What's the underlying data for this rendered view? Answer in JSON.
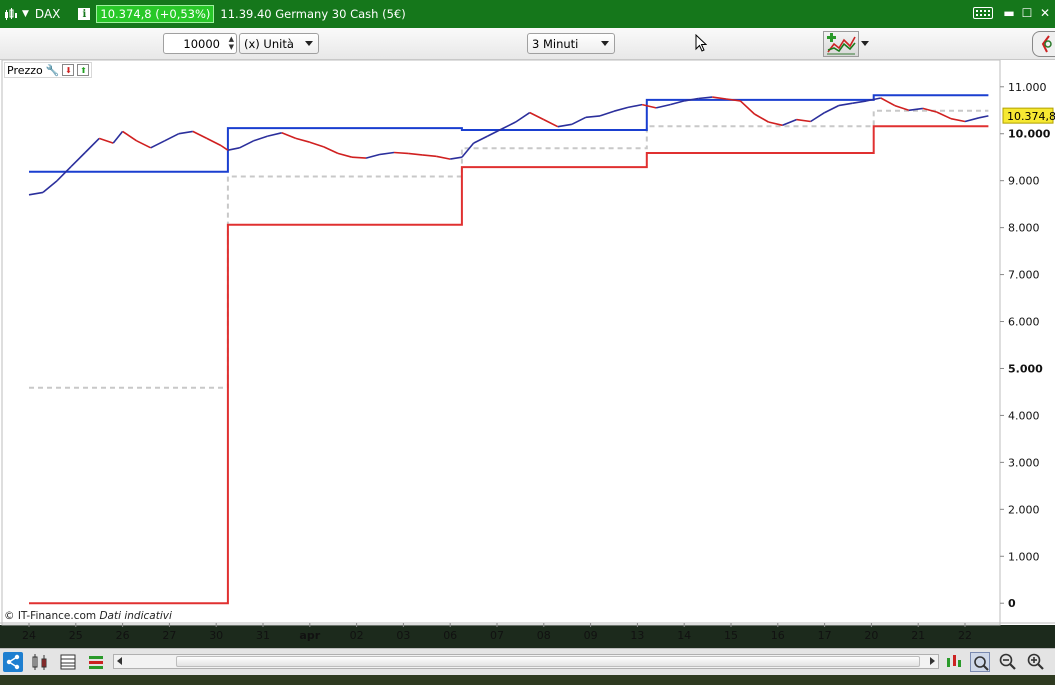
{
  "window": {
    "instrument": "DAX",
    "info_icon": "i",
    "price_badge": "10.374,8 (+0,53%)",
    "title": "11.39.40 Germany 30 Cash (5€)",
    "controls": [
      "minimize-icon",
      "maximize-icon",
      "close-icon"
    ]
  },
  "toolbar": {
    "quantity": "10000",
    "unit": "(x) Unità",
    "timeframe": "3 Minuti"
  },
  "chart_header": {
    "label": "Prezzo"
  },
  "footer": {
    "source": "© IT-Finance.com",
    "note": "Dati indicativi"
  },
  "colors": {
    "upper_channel": "#1a3fd0",
    "lower_channel": "#e03030",
    "midline": "#c8c8c8",
    "price": "#2b2f9c",
    "price_down": "#d02020",
    "last_price_bg": "#f6e832"
  },
  "chart_data": {
    "type": "line",
    "ylim": [
      -400,
      11400
    ],
    "yticks": [
      0,
      1000,
      2000,
      3000,
      4000,
      5000,
      6000,
      7000,
      8000,
      9000,
      10000,
      11000
    ],
    "ytick_labels": [
      "0",
      "1.000",
      "2.000",
      "3.000",
      "4.000",
      "5.000",
      "6.000",
      "7.000",
      "8.000",
      "9.000",
      "10.000",
      "11.000"
    ],
    "ytick_bold": [
      0,
      5000,
      10000
    ],
    "xtick_labels": [
      "24",
      "25",
      "26",
      "27",
      "30",
      "31",
      "apr",
      "02",
      "03",
      "06",
      "07",
      "08",
      "09",
      "13",
      "14",
      "15",
      "16",
      "17",
      "20",
      "21",
      "22"
    ],
    "xtick_bold": [
      "apr"
    ],
    "last_price": 10374.8,
    "last_price_label": "10.374,8",
    "upper_channel": [
      [
        0,
        9190
      ],
      [
        4.25,
        9190
      ],
      [
        4.25,
        10120
      ],
      [
        9.25,
        10120
      ],
      [
        9.25,
        10080
      ],
      [
        13.2,
        10080
      ],
      [
        13.2,
        10720
      ],
      [
        18.05,
        10720
      ],
      [
        18.05,
        10820
      ],
      [
        20.5,
        10820
      ]
    ],
    "lower_channel": [
      [
        0,
        0
      ],
      [
        4.25,
        0
      ],
      [
        4.25,
        8060
      ],
      [
        9.25,
        8060
      ],
      [
        9.25,
        9290
      ],
      [
        13.2,
        9290
      ],
      [
        13.2,
        9590
      ],
      [
        18.05,
        9590
      ],
      [
        18.05,
        10160
      ],
      [
        20.5,
        10160
      ]
    ],
    "midline": [
      [
        0,
        4590
      ],
      [
        4.25,
        4590
      ],
      [
        4.25,
        9090
      ],
      [
        9.25,
        9090
      ],
      [
        9.25,
        9690
      ],
      [
        13.2,
        9690
      ],
      [
        13.2,
        10160
      ],
      [
        18.05,
        10160
      ],
      [
        18.05,
        10490
      ],
      [
        20.5,
        10490
      ]
    ],
    "price": [
      [
        0,
        8700
      ],
      [
        0.3,
        8750
      ],
      [
        0.6,
        9000
      ],
      [
        0.9,
        9300
      ],
      [
        1.2,
        9600
      ],
      [
        1.5,
        9900
      ],
      [
        1.8,
        9800
      ],
      [
        2.0,
        10050
      ],
      [
        2.3,
        9850
      ],
      [
        2.6,
        9700
      ],
      [
        2.9,
        9850
      ],
      [
        3.2,
        10000
      ],
      [
        3.5,
        10050
      ],
      [
        3.8,
        9900
      ],
      [
        4.1,
        9750
      ],
      [
        4.25,
        9650
      ],
      [
        4.5,
        9700
      ],
      [
        4.8,
        9850
      ],
      [
        5.1,
        9950
      ],
      [
        5.4,
        10020
      ],
      [
        5.7,
        9900
      ],
      [
        6.0,
        9820
      ],
      [
        6.3,
        9720
      ],
      [
        6.6,
        9580
      ],
      [
        6.9,
        9500
      ],
      [
        7.2,
        9480
      ],
      [
        7.5,
        9560
      ],
      [
        7.8,
        9600
      ],
      [
        8.1,
        9580
      ],
      [
        8.4,
        9550
      ],
      [
        8.7,
        9520
      ],
      [
        9.0,
        9460
      ],
      [
        9.25,
        9500
      ],
      [
        9.5,
        9800
      ],
      [
        9.8,
        9950
      ],
      [
        10.1,
        10100
      ],
      [
        10.4,
        10250
      ],
      [
        10.7,
        10450
      ],
      [
        11.0,
        10300
      ],
      [
        11.3,
        10150
      ],
      [
        11.6,
        10200
      ],
      [
        11.9,
        10350
      ],
      [
        12.2,
        10380
      ],
      [
        12.5,
        10480
      ],
      [
        12.8,
        10560
      ],
      [
        13.1,
        10620
      ],
      [
        13.4,
        10550
      ],
      [
        13.7,
        10620
      ],
      [
        14.0,
        10700
      ],
      [
        14.3,
        10750
      ],
      [
        14.6,
        10780
      ],
      [
        14.9,
        10740
      ],
      [
        15.2,
        10700
      ],
      [
        15.5,
        10420
      ],
      [
        15.8,
        10250
      ],
      [
        16.1,
        10180
      ],
      [
        16.4,
        10300
      ],
      [
        16.7,
        10260
      ],
      [
        17.0,
        10450
      ],
      [
        17.3,
        10600
      ],
      [
        17.6,
        10650
      ],
      [
        17.9,
        10700
      ],
      [
        18.2,
        10760
      ],
      [
        18.5,
        10600
      ],
      [
        18.8,
        10500
      ],
      [
        19.1,
        10540
      ],
      [
        19.4,
        10460
      ],
      [
        19.7,
        10320
      ],
      [
        20.0,
        10260
      ],
      [
        20.3,
        10340
      ],
      [
        20.5,
        10380
      ]
    ]
  }
}
